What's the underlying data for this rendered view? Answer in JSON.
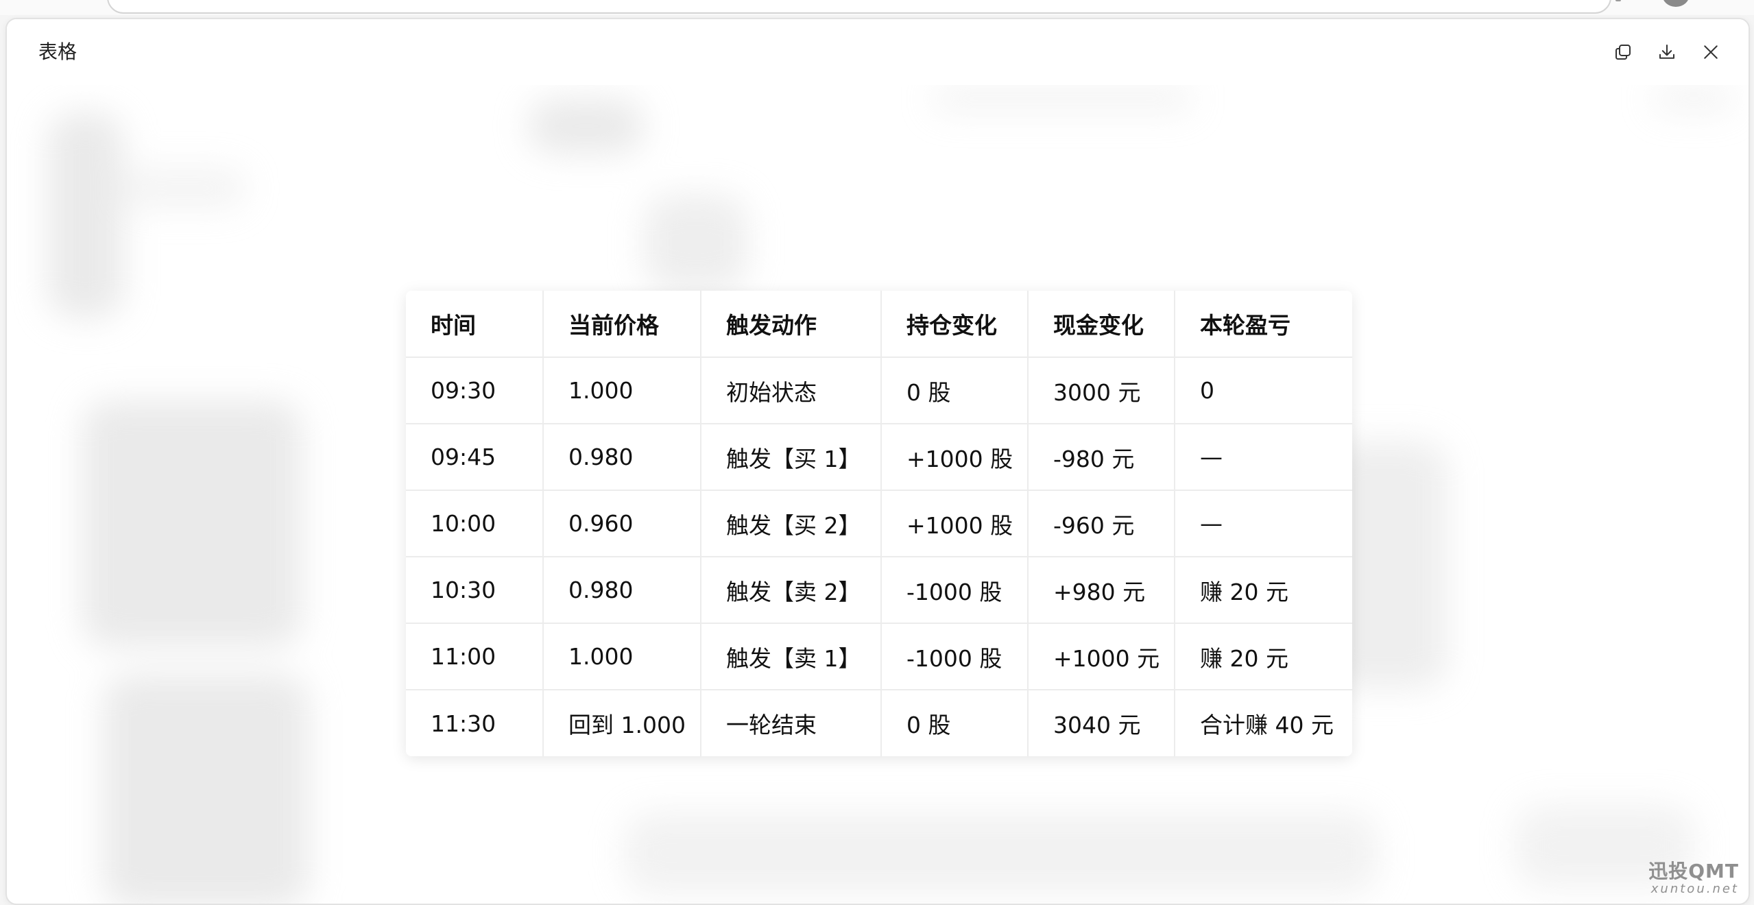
{
  "dialog": {
    "title": "表格",
    "actions": [
      {
        "icon": "copy-icon"
      },
      {
        "icon": "download-icon"
      },
      {
        "icon": "close-icon"
      }
    ]
  },
  "table": {
    "headers": [
      "时间",
      "当前价格",
      "触发动作",
      "持仓变化",
      "现金变化",
      "本轮盈亏"
    ],
    "rows": [
      [
        "09:30",
        "1.000",
        "初始状态",
        "0 股",
        "3000 元",
        "0"
      ],
      [
        "09:45",
        "0.980",
        "触发【买 1】",
        "+1000 股",
        "-980 元",
        "—"
      ],
      [
        "10:00",
        "0.960",
        "触发【买 2】",
        "+1000 股",
        "-960 元",
        "—"
      ],
      [
        "10:30",
        "0.980",
        "触发【卖 2】",
        "-1000 股",
        "+980 元",
        "赚 20 元"
      ],
      [
        "11:00",
        "1.000",
        "触发【卖 1】",
        "-1000 股",
        "+1000 元",
        "赚 20 元"
      ],
      [
        "11:30",
        "回到 1.000",
        "一轮结束",
        "0 股",
        "3040 元",
        "合计赚 40 元"
      ]
    ]
  },
  "watermark": {
    "name": "迅投QMT",
    "url": "xuntou.net"
  }
}
